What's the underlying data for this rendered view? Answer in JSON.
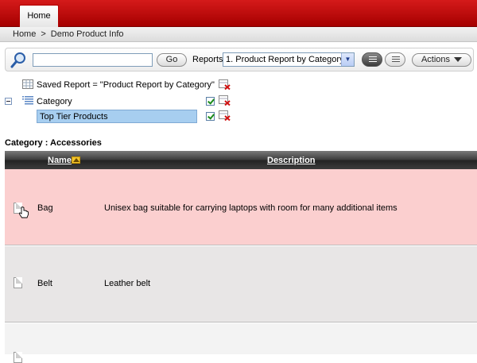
{
  "tabs": [
    {
      "label": "Home"
    }
  ],
  "breadcrumb": {
    "home": "Home",
    "separator": ">",
    "current": "Demo Product Info"
  },
  "toolbar": {
    "search_value": "",
    "go_label": "Go",
    "reports_label": "Reports",
    "reports_selected": "1. Product Report by Category",
    "actions_label": "Actions"
  },
  "filters": {
    "saved_report": "Saved Report = \"Product Report by Category\"",
    "control_break": "Category",
    "highlight": "Top Tier Products"
  },
  "group": {
    "heading": "Category : Accessories"
  },
  "table": {
    "columns": [
      {
        "label": "Name"
      },
      {
        "label": "Description"
      }
    ],
    "rows": [
      {
        "name": "Bag",
        "description": "Unisex bag suitable for carrying laptops with room for many additional items"
      },
      {
        "name": "Belt",
        "description": "Leather belt"
      },
      {
        "name": "",
        "description": ""
      }
    ]
  },
  "colors": {
    "tab_bar": "#c00000",
    "highlight_row": "#fbcfcf",
    "filter_highlight": "#a7cef0",
    "header": "#333333"
  }
}
